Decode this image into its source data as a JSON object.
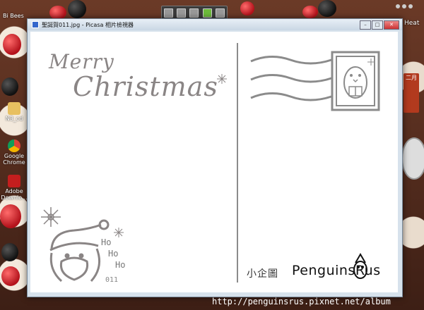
{
  "window": {
    "title": "聖誕賀011.jpg - Picasa 相片檢視器"
  },
  "desktop": {
    "icons": [
      {
        "label": "N3_cd"
      },
      {
        "label": "Google Chrome"
      },
      {
        "label": "Adobe Downlo..."
      }
    ],
    "side_text_top_left": "Bi Bees",
    "right_label": "Heat",
    "month_label": "二月"
  },
  "postcard": {
    "greeting_line1": "Merry",
    "greeting_line2": "Christmas",
    "hoho": [
      "Ho",
      "Ho",
      "Ho"
    ],
    "card_number": "011",
    "chinese_name": "小企圖",
    "brand": "PenguinsRus"
  },
  "watermark": {
    "url": "http://penguinsrus.pixnet.net/album"
  },
  "colors": {
    "window_frame": "#d7e2ec",
    "ink_gray": "#8a8585",
    "desktop_bg": "#4a2a1e"
  }
}
